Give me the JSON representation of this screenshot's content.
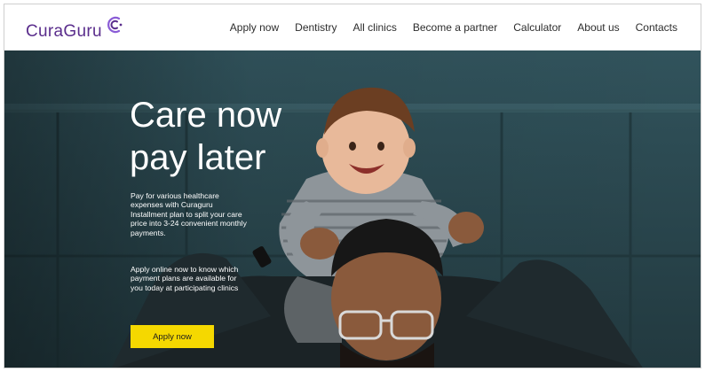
{
  "header": {
    "logo_text": "CuraGuru",
    "nav": [
      {
        "label": "Apply now"
      },
      {
        "label": "Dentistry"
      },
      {
        "label": "All clinics"
      },
      {
        "label": "Become a partner"
      },
      {
        "label": "Calculator"
      },
      {
        "label": "About us"
      },
      {
        "label": "Contacts"
      }
    ]
  },
  "hero": {
    "title_line1": "Care now",
    "title_line2": "pay later",
    "paragraph1": "Pay for various healthcare expenses with Curaguru Installment plan to split your care price into 3-24 convenient monthly payments.",
    "paragraph2": "Apply online now to know which payment plans are available for you today at participating clinics",
    "cta_label": "Apply now"
  },
  "colors": {
    "brand": "#5a2d8c",
    "accent": "#7a4fc0",
    "cta": "#f5d800",
    "hero_bg": "#2c4c55"
  },
  "icons": {
    "logo_mark": "cg-logo-mark"
  }
}
